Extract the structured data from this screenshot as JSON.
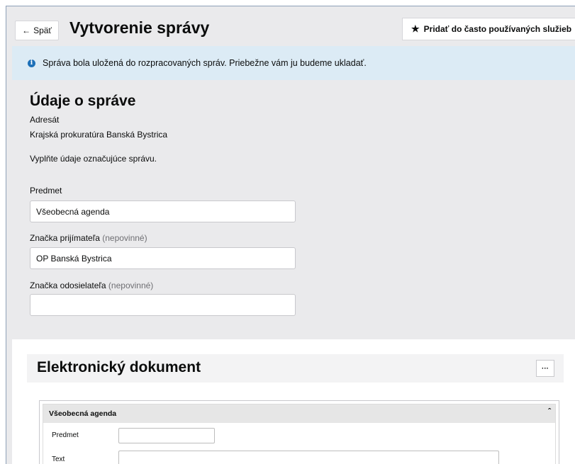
{
  "header": {
    "back_label": "Späť",
    "back_icon": "arrow-left-icon",
    "title": "Vytvorenie správy",
    "favorite_label": "Pridať do často používaných služieb",
    "favorite_icon": "star-icon"
  },
  "info": {
    "icon": "info-icon",
    "message": "Správa bola uložená do rozpracovaných správ. Priebežne vám ju budeme ukladať."
  },
  "message_details": {
    "title": "Údaje o správe",
    "recipient_label": "Adresát",
    "recipient_value": "Krajská prokuratúra Banská Bystrica",
    "instruction": "Vyplňte údaje označujúce správu.",
    "subject_label": "Predmet",
    "subject_value": "Všeobecná agenda",
    "recipient_ref_label": "Značka prijímateľa",
    "recipient_ref_optional": "(nepovinné)",
    "recipient_ref_value": "OP Banská Bystrica",
    "sender_ref_label": "Značka odosielateľa",
    "sender_ref_optional": "(nepovinné)",
    "sender_ref_value": ""
  },
  "document": {
    "title": "Elektronický dokument",
    "more_label": "···",
    "form_title": "Všeobecná agenda",
    "collapse_icon": "chevron-up-icon",
    "subject_label": "Predmet",
    "text_label": "Text"
  },
  "colors": {
    "background": "#eaeaec",
    "info_background": "#dcebf5",
    "info_icon": "#1d70b8"
  }
}
